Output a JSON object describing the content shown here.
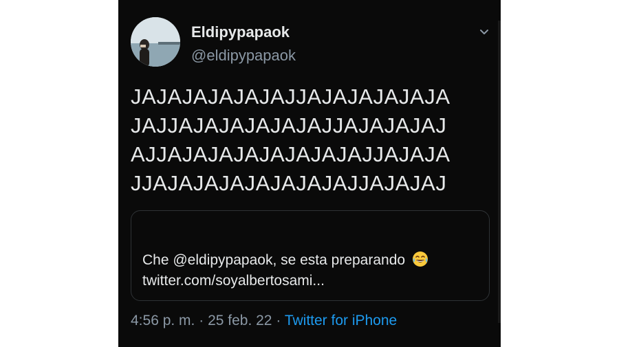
{
  "tweet": {
    "author": {
      "display_name": "Eldipypapaok",
      "handle": "@eldipypapaok"
    },
    "text_lines": [
      "JAJAJAJAJAJAJJAJAJAJAJAJA",
      "JAJJAJAJAJAJAJAJJAJAJAJAJ",
      "AJJAJAJAJAJAJAJAJAJJAJAJA",
      "JJAJAJAJAJAJAJAJAJJAJAJAJ"
    ],
    "quote": {
      "line1": "Che @eldipypapaok, se esta preparando",
      "emoji": "face-with-tears-of-joy",
      "line2": "twitter.com/soyalbertosami..."
    },
    "meta": {
      "time": "4:56 p. m.",
      "separator": "·",
      "date": "25 feb. 22",
      "source": "Twitter for iPhone"
    }
  },
  "colors": {
    "background": "#0a0a0a",
    "text": "#e7e9ea",
    "secondary": "#8b98a5",
    "link": "#1d9bf0",
    "border": "#2f3336"
  },
  "icons": {
    "more": "chevron-down-icon"
  }
}
